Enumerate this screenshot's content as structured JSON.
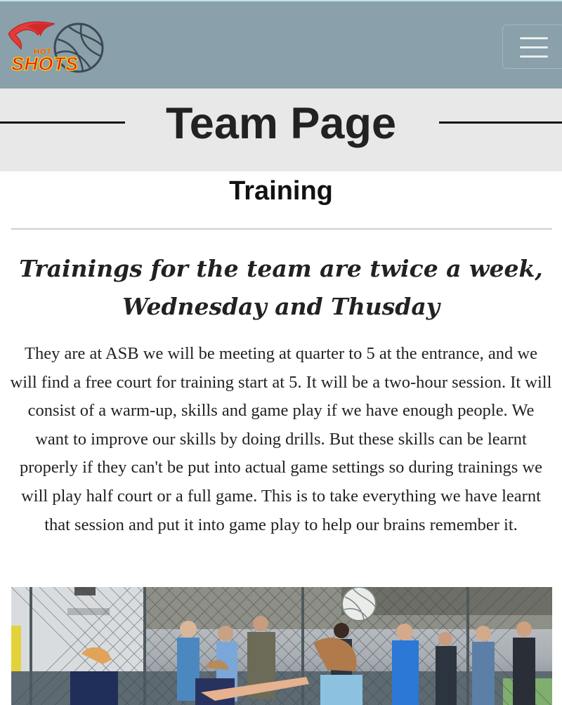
{
  "header": {
    "logo_alt": "HOT SHOTS",
    "logo_hot": "HOT",
    "logo_shots": "SHOTS",
    "menu_icon": "hamburger-icon"
  },
  "page": {
    "title": "Team Page",
    "section_heading": "Training",
    "subheading": "Trainings for the team are twice a week, Wednesday and Thusday",
    "body": "They are at ASB we will be meeting at quarter to 5 at the entrance, and we will find a free court for training start at 5. It will be a two-hour session. It will consist of a warm-up, skills and game play if we have enough people. We want to improve our skills by doing drills. But these skills can be learnt properly if they can't be put into actual game settings so during trainings we will play half court or a full game. This is to take everything we have learnt that session and put it into game play to help our brains remember it."
  },
  "colors": {
    "navbar": "#8aa0aa",
    "title_band": "#e8e8e8",
    "logo_red": "#e21b1b",
    "logo_gold": "#f4c51c"
  }
}
